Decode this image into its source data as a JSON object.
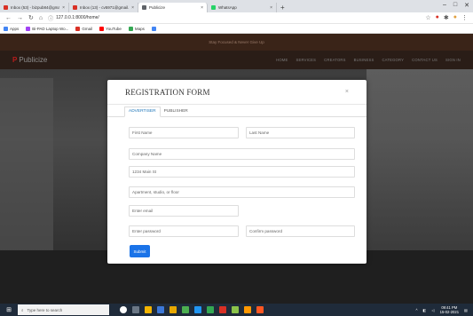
{
  "browser": {
    "tabs": [
      {
        "label": "Inbox (53) - bizpub84@gmail.c",
        "color": "#d93025",
        "active": false
      },
      {
        "label": "Inbox (13) - cv5971@gmail.c",
        "color": "#d93025",
        "active": false
      },
      {
        "label": "Publicize",
        "color": "#5f6368",
        "active": true
      },
      {
        "label": "WhatsApp",
        "color": "#25d366",
        "active": false
      }
    ],
    "new_tab": "+",
    "url": "127.0.0.1:8000/home/",
    "bookmarks": [
      {
        "label": "Apps",
        "color": "#4285f4"
      },
      {
        "label": "Bi-PAD Laptop Wo...",
        "color": "#a142f4"
      },
      {
        "label": "Gmail",
        "color": "#d93025"
      },
      {
        "label": "YouTube",
        "color": "#ff0000"
      },
      {
        "label": "Maps",
        "color": "#34a853"
      },
      {
        "label": "",
        "color": "#4285f4"
      }
    ]
  },
  "site": {
    "top_strip": "Stay Focused & Never Give Up",
    "logo_mark": "P",
    "logo_text": "Publicize",
    "menu": [
      "HOME",
      "SERVICES",
      "CREATORS",
      "BUSINESS",
      "CATEGORY",
      "CONTACT US",
      "SIGN IN"
    ]
  },
  "modal": {
    "title": "REGISTRATION FORM",
    "close": "×",
    "tabs": [
      {
        "label": "ADVERTISER",
        "active": true
      },
      {
        "label": "PUBLISHER",
        "active": false
      }
    ],
    "fields": {
      "first_name": "First Name",
      "last_name": "Last Name",
      "company": "Company Name",
      "address": "1234 Main St",
      "address2": "Apartment, studio, or floor",
      "email": "Enter email",
      "password": "Enter password",
      "confirm": "Confirm password"
    },
    "submit": "Submit",
    "submit_color": "#1a73e8"
  },
  "taskbar": {
    "search": "Type here to search",
    "time": "09:41 PM",
    "date": "15-02-2021"
  }
}
